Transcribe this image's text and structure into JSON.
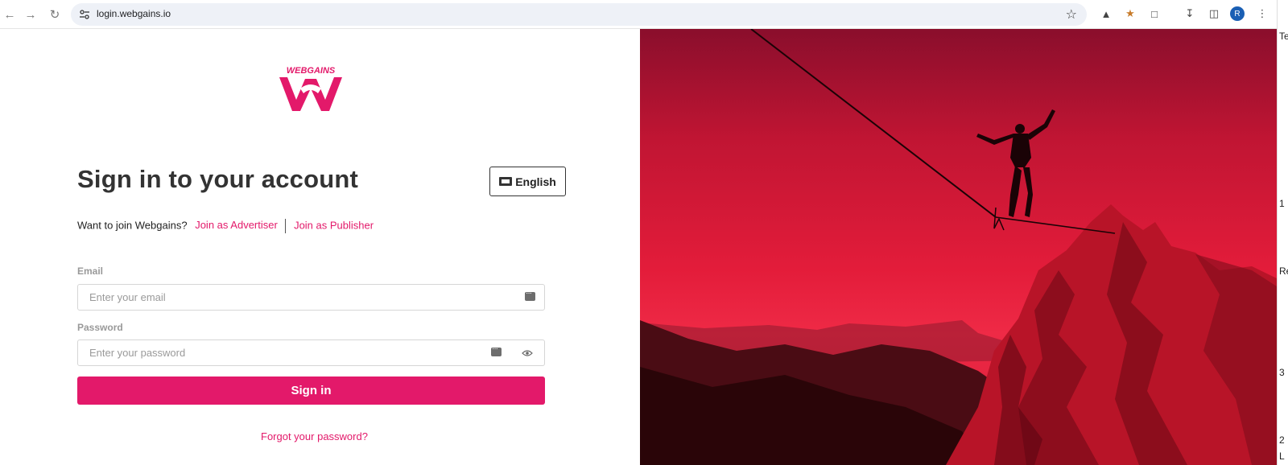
{
  "browser": {
    "url": "login.webgains.io",
    "profile_initial": "R",
    "side_strip_chars": [
      "Te",
      "1",
      "Re",
      "3",
      "2",
      "L"
    ]
  },
  "login": {
    "logo_text": "WEBGAINS",
    "title": "Sign in to your account",
    "language_button": "English",
    "join_prompt": "Want to join Webgains?",
    "join_advertiser": "Join as Advertiser",
    "join_publisher": "Join as Publisher",
    "email_label": "Email",
    "email_placeholder": "Enter your email",
    "password_label": "Password",
    "password_placeholder": "Enter your password",
    "signin_button": "Sign in",
    "forgot_link": "Forgot your password?"
  },
  "colors": {
    "brand": "#e3196a",
    "hero_red": "#e31c3a"
  }
}
